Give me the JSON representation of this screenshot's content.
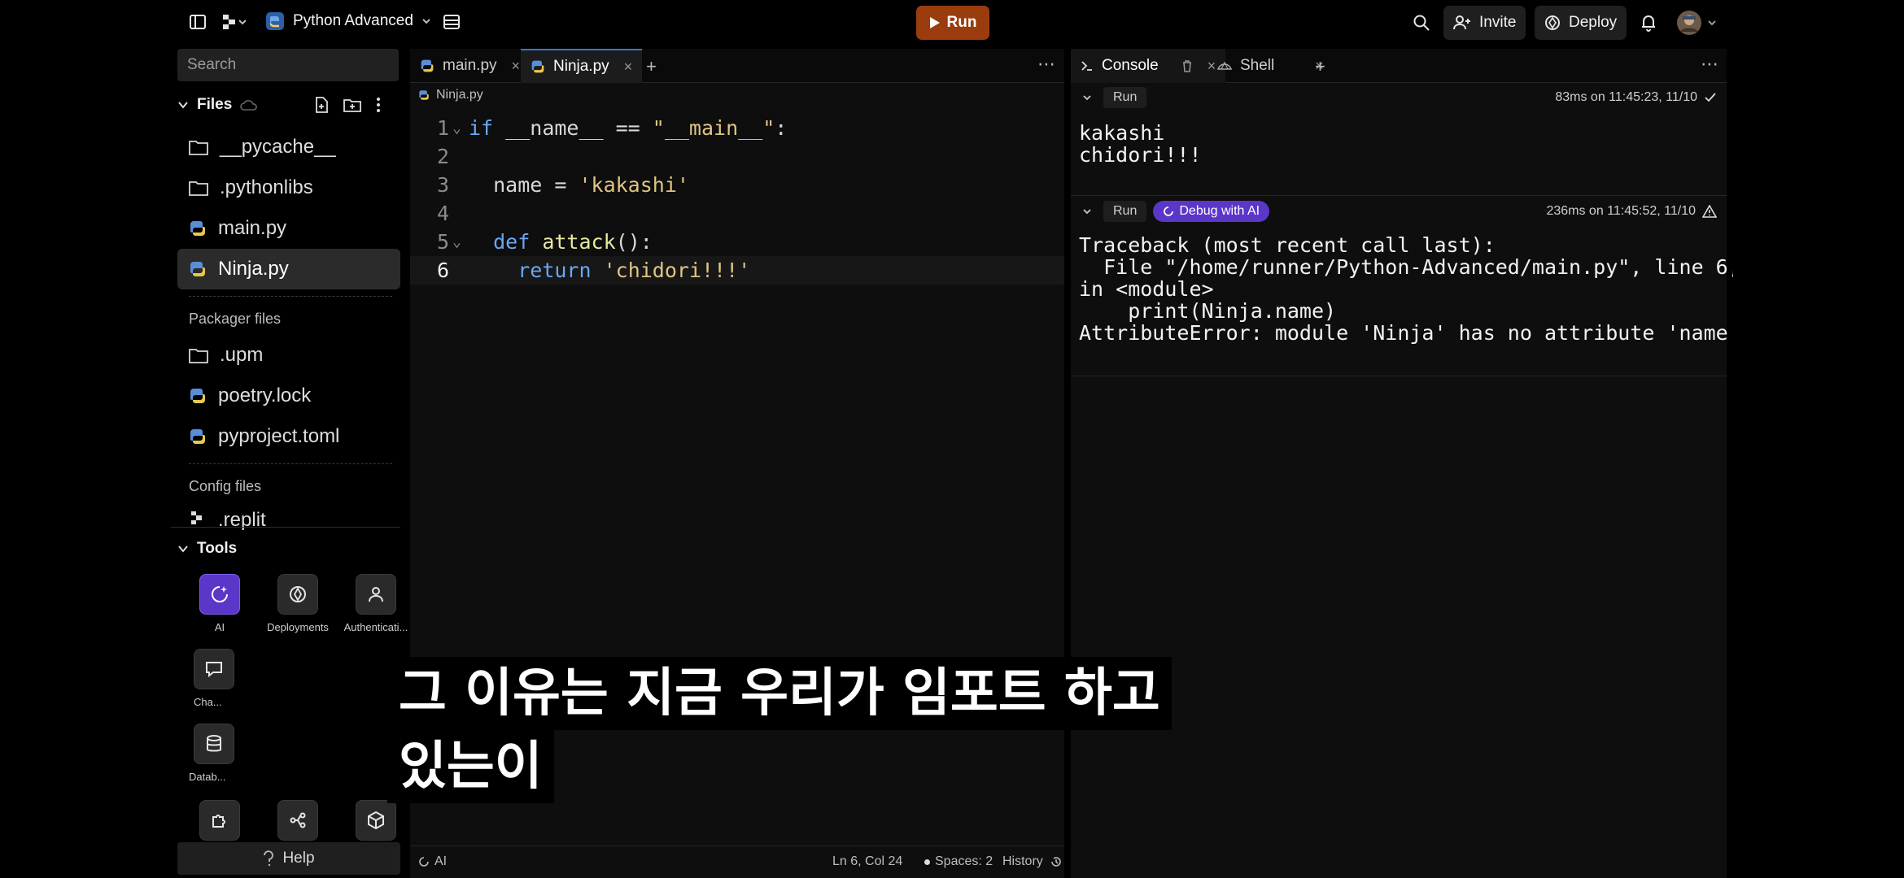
{
  "topbar": {
    "project_name": "Python Advanced",
    "run_label": "Run",
    "invite_label": "Invite",
    "deploy_label": "Deploy"
  },
  "sidebar": {
    "search_placeholder": "Search",
    "files_title": "Files",
    "files": [
      {
        "name": "__pycache__",
        "type": "folder"
      },
      {
        "name": ".pythonlibs",
        "type": "folder"
      },
      {
        "name": "main.py",
        "type": "python"
      },
      {
        "name": "Ninja.py",
        "type": "python",
        "active": true
      }
    ],
    "packager_title": "Packager files",
    "packager_files": [
      {
        "name": ".upm",
        "type": "folder"
      },
      {
        "name": "poetry.lock",
        "type": "python"
      },
      {
        "name": "pyproject.toml",
        "type": "python"
      }
    ],
    "config_title": "Config files",
    "config_files": [
      {
        "name": ".replit",
        "type": "replit"
      }
    ],
    "tools_title": "Tools",
    "tools": [
      {
        "label": "AI",
        "icon": "ai-icon"
      },
      {
        "label": "Deployments",
        "icon": "deploy-icon"
      },
      {
        "label": "Authenticati...",
        "icon": "user-icon"
      },
      {
        "label": "Cha...",
        "icon": "chat-icon"
      },
      {
        "label": "Datab...",
        "icon": "database-icon"
      }
    ],
    "help_label": "Help"
  },
  "editor": {
    "tabs": [
      {
        "label": "main.py",
        "active": false
      },
      {
        "label": "Ninja.py",
        "active": true
      }
    ],
    "breadcrumb": "Ninja.py",
    "status": {
      "ai": "AI",
      "position": "Ln 6, Col 24",
      "spaces": "Spaces: 2",
      "history": "History"
    }
  },
  "code_lines": [
    {
      "n": "1",
      "fold": true,
      "parts": [
        [
          "kw",
          "if"
        ],
        [
          "txt",
          " __name__ == "
        ],
        [
          "str",
          "\"__main__\""
        ],
        [
          "txt",
          ":"
        ]
      ]
    },
    {
      "n": "2",
      "fold": false,
      "parts": []
    },
    {
      "n": "3",
      "fold": false,
      "parts": [
        [
          "txt",
          "  name = "
        ],
        [
          "str",
          "'kakashi'"
        ]
      ]
    },
    {
      "n": "4",
      "fold": false,
      "parts": []
    },
    {
      "n": "5",
      "fold": true,
      "parts": [
        [
          "txt",
          "  "
        ],
        [
          "kw",
          "def"
        ],
        [
          "txt",
          " "
        ],
        [
          "fn",
          "attack"
        ],
        [
          "txt",
          "():"
        ]
      ]
    },
    {
      "n": "6",
      "fold": false,
      "current": true,
      "parts": [
        [
          "txt",
          "    "
        ],
        [
          "kw",
          "return"
        ],
        [
          "txt",
          " "
        ],
        [
          "str",
          "'chidori!!!'"
        ]
      ]
    }
  ],
  "console": {
    "tabs": [
      {
        "label": "Console",
        "active": true
      },
      {
        "label": "Shell",
        "active": false
      }
    ],
    "run1": {
      "label": "Run",
      "meta": "83ms on 11:45:23, 11/10",
      "output": "kakashi\nchidori!!!"
    },
    "run2": {
      "label": "Run",
      "debug_label": "Debug with AI",
      "meta": "236ms on 11:45:52, 11/10",
      "output": "Traceback (most recent call last):\n  File \"/home/runner/Python-Advanced/main.py\", line 6,\nin <module>\n    print(Ninja.name)\nAttributeError: module 'Ninja' has no attribute 'name'"
    }
  },
  "subtitle": {
    "line1": "그 이유는 지금 우리가 임포트 하고",
    "line2": "있는이"
  },
  "colors": {
    "run_button": "#9a3c0e",
    "ai_purple": "#5a36c9",
    "keyword": "#6aa7f2",
    "string": "#e0c483"
  }
}
